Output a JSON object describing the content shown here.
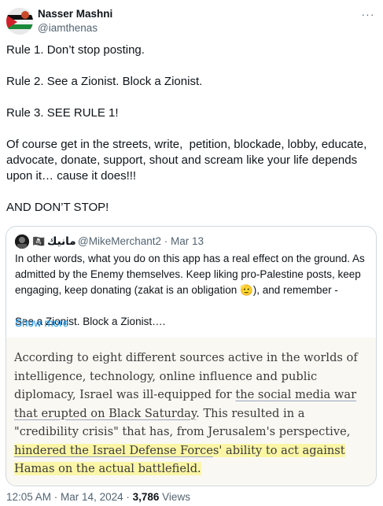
{
  "author": {
    "display_name": "Nasser Mashni",
    "handle": "@iamthenas"
  },
  "more_label": "···",
  "tweet_lines": [
    "Rule 1. Don’t stop posting.",
    "",
    "Rule 2. See a Zionist. Block a Zionist.",
    "",
    "Rule 3. SEE RULE 1!",
    "",
    "Of course get in the streets, write,  petition, blockade, lobby, educate, advocate, donate, support, shout and scream like your life depends upon it… cause it does!!!",
    "",
    "AND DON’T STOP!"
  ],
  "quoted": {
    "flag": "🏴‍☠️",
    "name": "مانيك",
    "handle": "@MikeMerchant2",
    "date": "Mar 13",
    "text_part1": "In other words, what you do on this app has a real effect on the ground. As admitted by the Enemy themselves. Keep liking pro-Palestine posts, keep engaging, keep donating (zakat is an obligation ",
    "emoji": "🫡",
    "text_part2": "), and remember -",
    "text_line3": "See a Zionist. Block a Zionist….",
    "show_more": "Show more",
    "article": {
      "seg1": "According to eight different sources active in the worlds of intelligence, technology, online influence and public diplomacy, Israel was ill-equipped for ",
      "seg2_link": "the social media war that erupted on Black Saturday",
      "seg3": ". This resulted in a \"credibility crisis\" that has, from Jerusalem's perspective, ",
      "seg4_link_highlight": "hindered the Israel Defense Force",
      "seg5_highlight": "s' ability to act against Hamas on the actual battlefield."
    }
  },
  "meta": {
    "time": "12:05 AM",
    "date": "Mar 14, 2024",
    "views_count": "3,786",
    "views_label": "Views"
  },
  "colors": {
    "accent_link": "#1d9bf0",
    "secondary_text": "#536471",
    "highlight": "#fbf6a6",
    "article_bg": "#faf8f3"
  }
}
